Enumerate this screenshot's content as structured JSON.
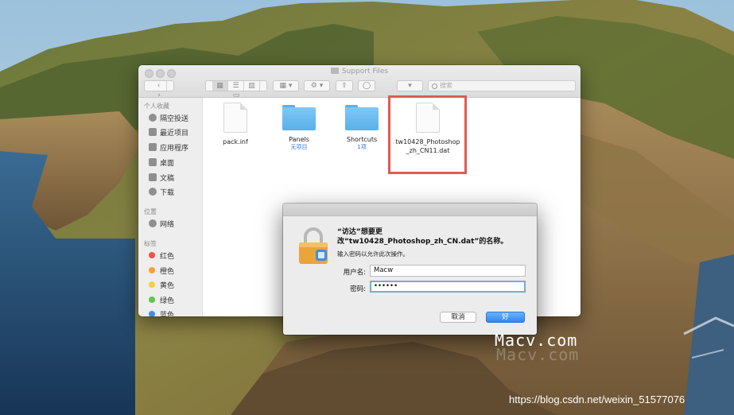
{
  "finder": {
    "window_title": "Support Files",
    "search_placeholder": "搜索",
    "sidebar": {
      "favorites_header": "个人收藏",
      "favorites": [
        {
          "label": "隔空投送",
          "icon": "airdrop-icon"
        },
        {
          "label": "最近项目",
          "icon": "recents-icon"
        },
        {
          "label": "应用程序",
          "icon": "applications-icon"
        },
        {
          "label": "桌面",
          "icon": "desktop-icon"
        },
        {
          "label": "文稿",
          "icon": "documents-icon"
        },
        {
          "label": "下载",
          "icon": "downloads-icon"
        }
      ],
      "locations_header": "位置",
      "locations": [
        {
          "label": "网络",
          "icon": "network-icon"
        }
      ],
      "tags_header": "标签",
      "tags": [
        {
          "label": "红色",
          "color": "#f0524c"
        },
        {
          "label": "橙色",
          "color": "#f6a03b"
        },
        {
          "label": "黄色",
          "color": "#f7cf3f"
        },
        {
          "label": "绿色",
          "color": "#5ec54e"
        },
        {
          "label": "蓝色",
          "color": "#3f8ef2"
        }
      ]
    },
    "files": [
      {
        "name": "pack.inf",
        "kind": "document",
        "sub": ""
      },
      {
        "name": "Panels",
        "kind": "folder",
        "sub": "无项目"
      },
      {
        "name": "Shortcuts",
        "kind": "folder",
        "sub": "1项"
      },
      {
        "name": "tw10428_Photoshop_zh_CN11.dat",
        "kind": "document",
        "sub": ""
      }
    ]
  },
  "dialog": {
    "title": "“访达”想要更改“tw10428_Photoshop_zh_CN.dat”的名称。",
    "subtitle": "输入密码以允许此次操作。",
    "username_label": "用户名:",
    "username_value": "Macw",
    "password_label": "密码:",
    "password_value": "••••••",
    "cancel_label": "取消",
    "ok_label": "好",
    "accent_color": "#2f86f3"
  },
  "watermarks": {
    "brand": "Macv.com",
    "url": "https://blog.csdn.net/weixin_51577076"
  }
}
